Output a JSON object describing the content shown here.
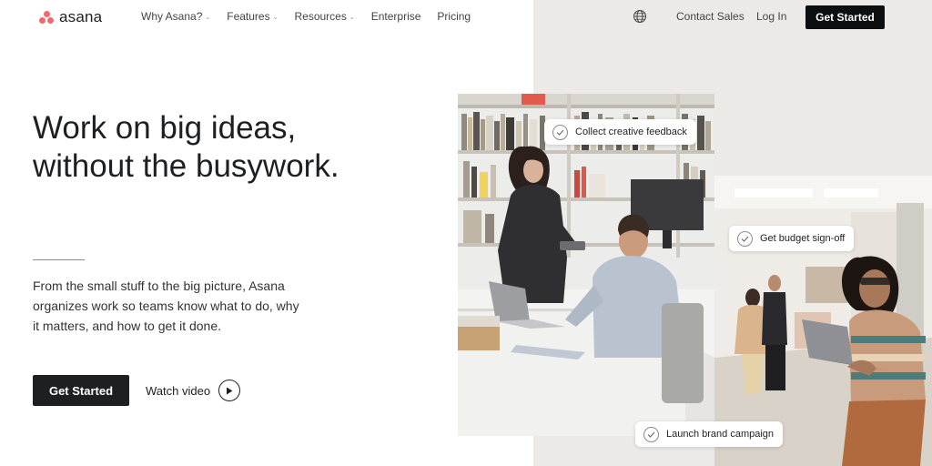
{
  "brand": {
    "name": "asana",
    "accent": "#f06a6a"
  },
  "nav": {
    "items": [
      {
        "label": "Why Asana?",
        "has_dropdown": true
      },
      {
        "label": "Features",
        "has_dropdown": true
      },
      {
        "label": "Resources",
        "has_dropdown": true
      },
      {
        "label": "Enterprise",
        "has_dropdown": false
      },
      {
        "label": "Pricing",
        "has_dropdown": false
      }
    ],
    "language_icon": "globe-icon",
    "contact_label": "Contact Sales",
    "login_label": "Log In",
    "cta_label": "Get Started"
  },
  "hero": {
    "headline_line1": "Work on big ideas,",
    "headline_line2": "without the busywork.",
    "subtext": "From the small stuff to the big picture, Asana organizes work so teams know what to do, why it matters, and how to get it done.",
    "cta_label": "Get Started",
    "video_label": "Watch video",
    "video_icon": "play-icon"
  },
  "task_chips": [
    {
      "label": "Collect creative feedback",
      "icon": "check-circle-icon"
    },
    {
      "label": "Get budget sign-off",
      "icon": "check-circle-icon"
    },
    {
      "label": "Launch brand campaign",
      "icon": "check-circle-icon"
    }
  ]
}
